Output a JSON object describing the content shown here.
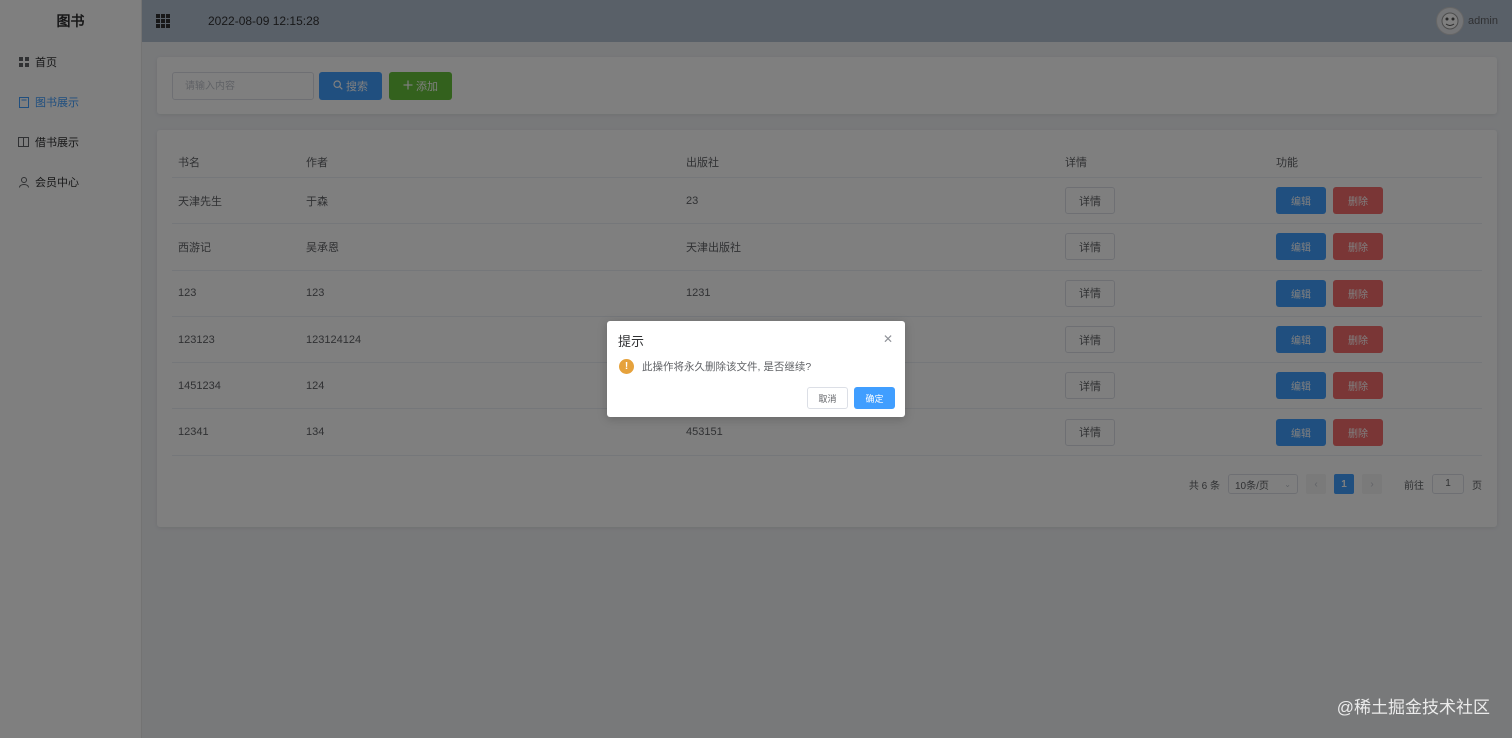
{
  "sidebar": {
    "title": "图书",
    "items": [
      {
        "label": "首页",
        "icon": "grid-icon"
      },
      {
        "label": "图书展示",
        "icon": "book-icon",
        "active": true
      },
      {
        "label": "借书展示",
        "icon": "open-book-icon"
      },
      {
        "label": "会员中心",
        "icon": "user-icon"
      }
    ]
  },
  "header": {
    "datetime": "2022-08-09 12:15:28",
    "username": "admin"
  },
  "search": {
    "placeholder": "请输入内容",
    "search_label": "搜索",
    "add_label": "添加"
  },
  "table": {
    "columns": [
      "书名",
      "作者",
      "出版社",
      "详情",
      "功能"
    ],
    "rows": [
      {
        "name": "天津先生",
        "author": "于森",
        "publisher": "23"
      },
      {
        "name": "西游记",
        "author": "吴承恩",
        "publisher": "天津出版社"
      },
      {
        "name": "123",
        "author": "123",
        "publisher": "1231"
      },
      {
        "name": "123123",
        "author": "123124124",
        "publisher": ""
      },
      {
        "name": "1451234",
        "author": "124",
        "publisher": ""
      },
      {
        "name": "12341",
        "author": "134",
        "publisher": "453151"
      }
    ],
    "detail_label": "详情",
    "edit_label": "编辑",
    "delete_label": "删除"
  },
  "pagination": {
    "total_text": "共 6 条",
    "page_size": "10条/页",
    "current_page": "1",
    "goto_label": "前往",
    "goto_value": "1",
    "page_suffix": "页"
  },
  "dialog": {
    "title": "提示",
    "message": "此操作将永久删除该文件, 是否继续?",
    "cancel_label": "取消",
    "confirm_label": "确定"
  },
  "watermark": "@稀土掘金技术社区",
  "colors": {
    "primary": "#409eff",
    "success": "#67c23a",
    "danger": "#f56c6c",
    "warning": "#e6a23c",
    "header_bg": "#b3c0d1"
  }
}
